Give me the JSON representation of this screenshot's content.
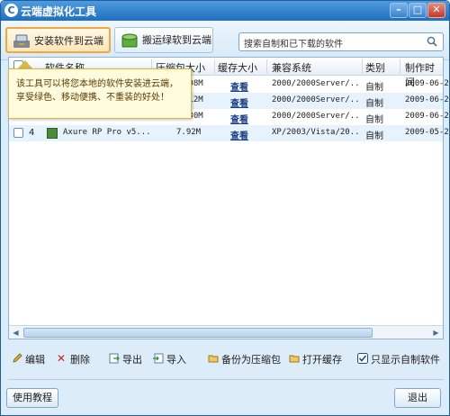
{
  "window": {
    "title": "云端虚拟化工具"
  },
  "toolbar": {
    "install_label": "安装软件到云端",
    "move_label": "搬运绿软到云端",
    "search_placeholder": "搜索自制和已下载的软件"
  },
  "tooltip": {
    "text": "该工具可以将您本地的软件安装进云端，享受绿色、移动便携、不重装的好处！"
  },
  "table": {
    "headers": [
      "软件名称",
      "压缩包大小",
      "缓存大小",
      "兼容系统",
      "类别",
      "制作时间"
    ],
    "rows": [
      {
        "num": "",
        "name": "",
        "size": ".08M",
        "cache": "查看",
        "os": "2000/2000Server/...",
        "type": "自制",
        "date": "2009-06-2"
      },
      {
        "num": "",
        "name": "",
        "size": ".12M",
        "cache": "查看",
        "os": "2000/2000Server/...",
        "type": "自制",
        "date": "2009-06-2"
      },
      {
        "num": "",
        "name": "",
        "size": ".30M",
        "cache": "查看",
        "os": "2000/2000Server/...",
        "type": "自制",
        "date": "2009-06-2"
      },
      {
        "num": "4",
        "name": "Axure RP Pro v5....",
        "size": "7.92M",
        "cache": "查看",
        "os": "XP/2003/Vista/20...",
        "type": "自制",
        "date": "2009-05-2"
      }
    ]
  },
  "actions": {
    "edit": "编辑",
    "delete": "删除",
    "export": "导出",
    "import": "导入",
    "backup": "备份为压缩包",
    "open_cache": "打开缓存",
    "only_self": "只显示自制软件"
  },
  "footer": {
    "tutorial": "使用教程",
    "exit": "退出"
  },
  "colors": {
    "accent": "#1f6ec0",
    "highlight": "#f2a93b",
    "tooltip_bg": "#fffbdc"
  }
}
